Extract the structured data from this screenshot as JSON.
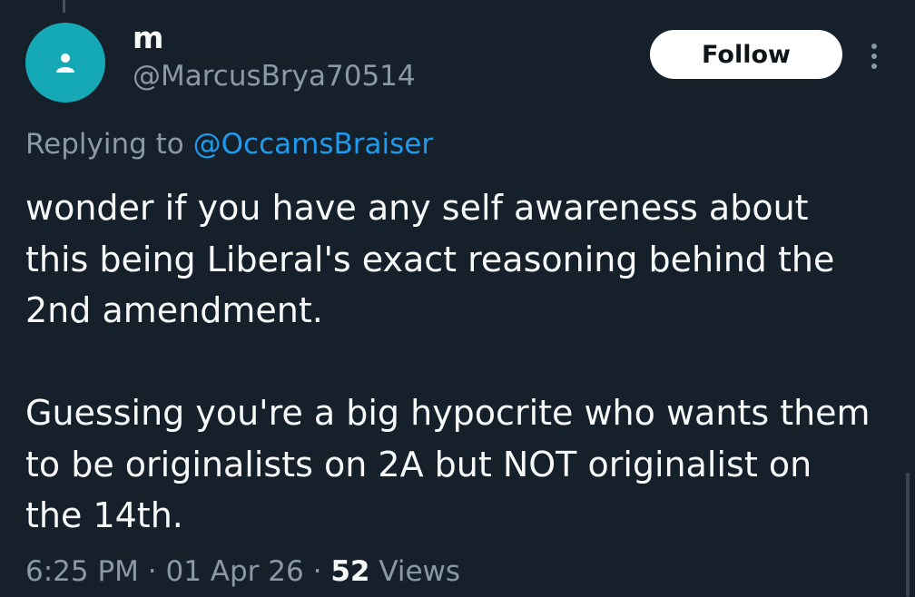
{
  "tweet": {
    "author": {
      "display_name": "m",
      "handle": "@MarcusBrya70514",
      "avatar_icon": "default-user-icon",
      "avatar_color": "#15a8b5"
    },
    "follow_label": "Follow",
    "more_icon": "vertical-ellipsis-icon",
    "replying_prefix": "Replying to",
    "replying_to": "@OccamsBraiser",
    "body": {
      "paragraph1_line1": "wonder if you have any self awareness about",
      "paragraph1_line2": "this being Liberal's exact reasoning behind the",
      "paragraph1_line3": "2nd amendment.",
      "paragraph2_line1": "Guessing you're a big hypocrite who wants them",
      "paragraph2_line2": "to be originalists on 2A but NOT originalist on",
      "paragraph2_line3": "the 14th."
    },
    "time": "6:25 PM",
    "date": "01 Apr 26",
    "views_count": "52",
    "views_label": "Views"
  },
  "colors": {
    "background": "#15202b",
    "text_primary": "#f7f9f9",
    "text_secondary": "#8b98a5",
    "link": "#1d9bf0",
    "follow_bg": "#ffffff"
  }
}
